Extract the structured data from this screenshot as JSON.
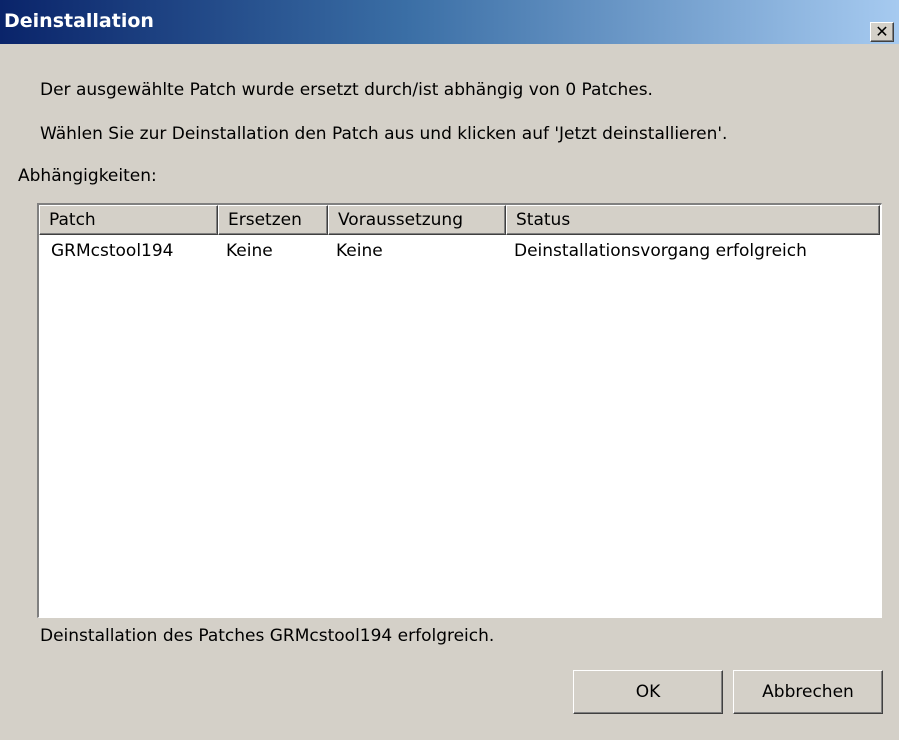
{
  "window": {
    "title": "Deinstallation",
    "close_glyph": "✕"
  },
  "messages": {
    "line1": "Der ausgewählte Patch wurde ersetzt durch/ist abhängig von 0 Patches.",
    "line2": "Wählen Sie zur Deinstallation den Patch aus und klicken auf 'Jetzt deinstallieren'."
  },
  "dependencies": {
    "label": "Abhängigkeiten:",
    "columns": [
      "Patch",
      "Ersetzen",
      "Voraussetzung",
      "Status"
    ],
    "rows": [
      [
        "GRMcstool194",
        "Keine",
        "Keine",
        "Deinstallationsvorgang erfolgreich"
      ]
    ]
  },
  "status_message": "Deinstallation des Patches GRMcstool194 erfolgreich.",
  "buttons": {
    "ok": "OK",
    "cancel": "Abbrechen"
  },
  "colors": {
    "titlebar_start": "#0a246a",
    "titlebar_end": "#a6caf0",
    "dialog_background": "#d4d0c8"
  }
}
